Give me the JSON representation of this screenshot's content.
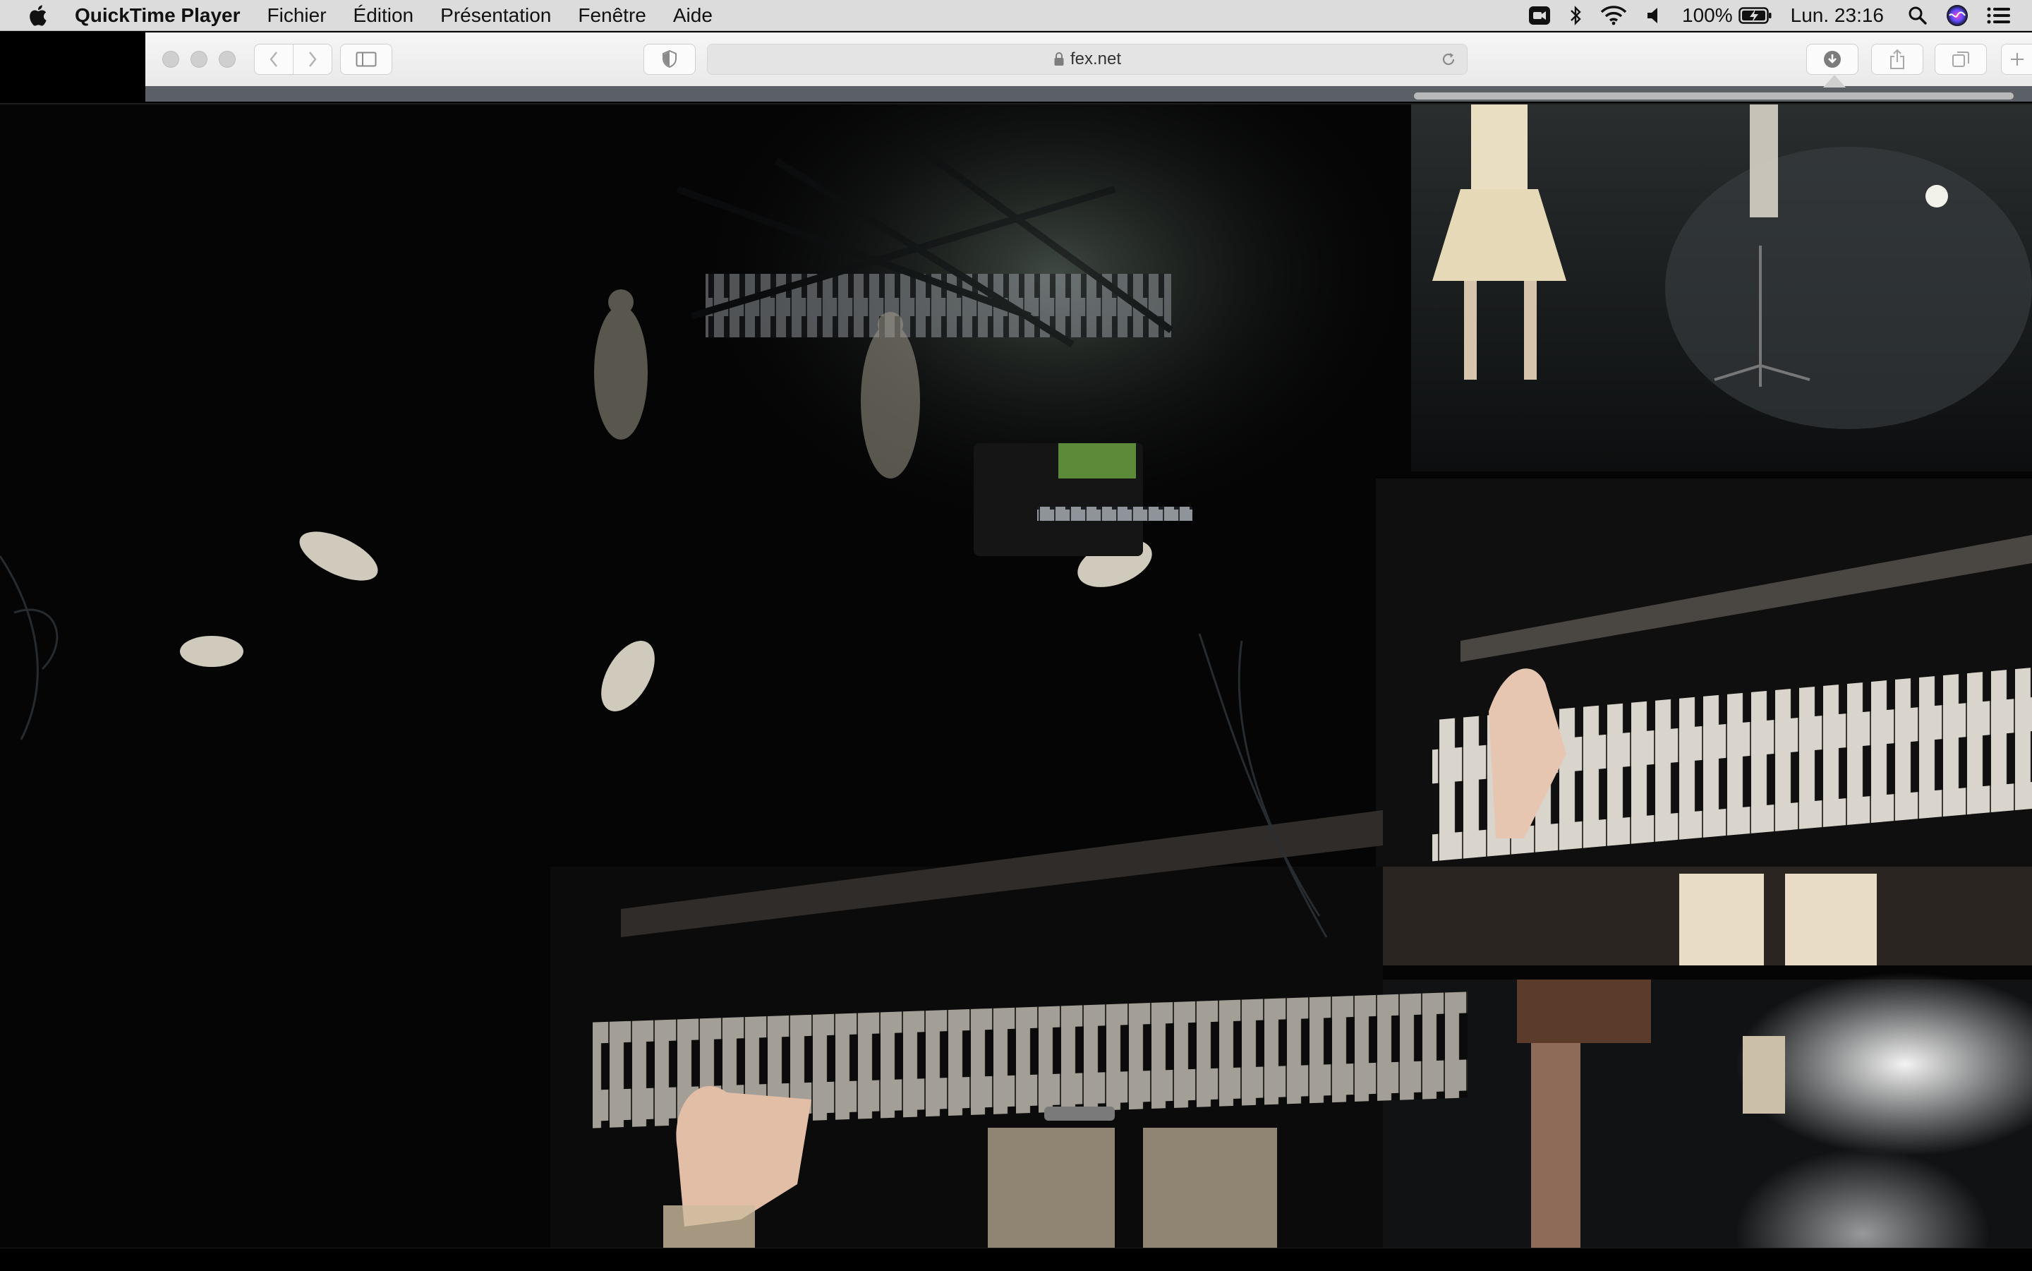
{
  "menubar": {
    "app_name": "QuickTime Player",
    "menus": [
      "Fichier",
      "Édition",
      "Présentation",
      "Fenêtre",
      "Aide"
    ],
    "status": {
      "battery_percent": "100%",
      "clock": "Lun. 23:16"
    }
  },
  "browser": {
    "url": "fex.net"
  },
  "icons": {
    "apple": "apple-icon",
    "screen_record": "screen-record-icon",
    "bluetooth": "bluetooth-icon",
    "wifi": "wifi-icon",
    "volume": "volume-icon",
    "battery": "battery-charging-icon",
    "spotlight": "search-icon",
    "siri": "siri-icon",
    "notification_center": "list-icon"
  },
  "colors": {
    "menubar_bg": "#dcdcdc",
    "toolbar_bg": "#efefef",
    "video_bg": "#050505"
  }
}
